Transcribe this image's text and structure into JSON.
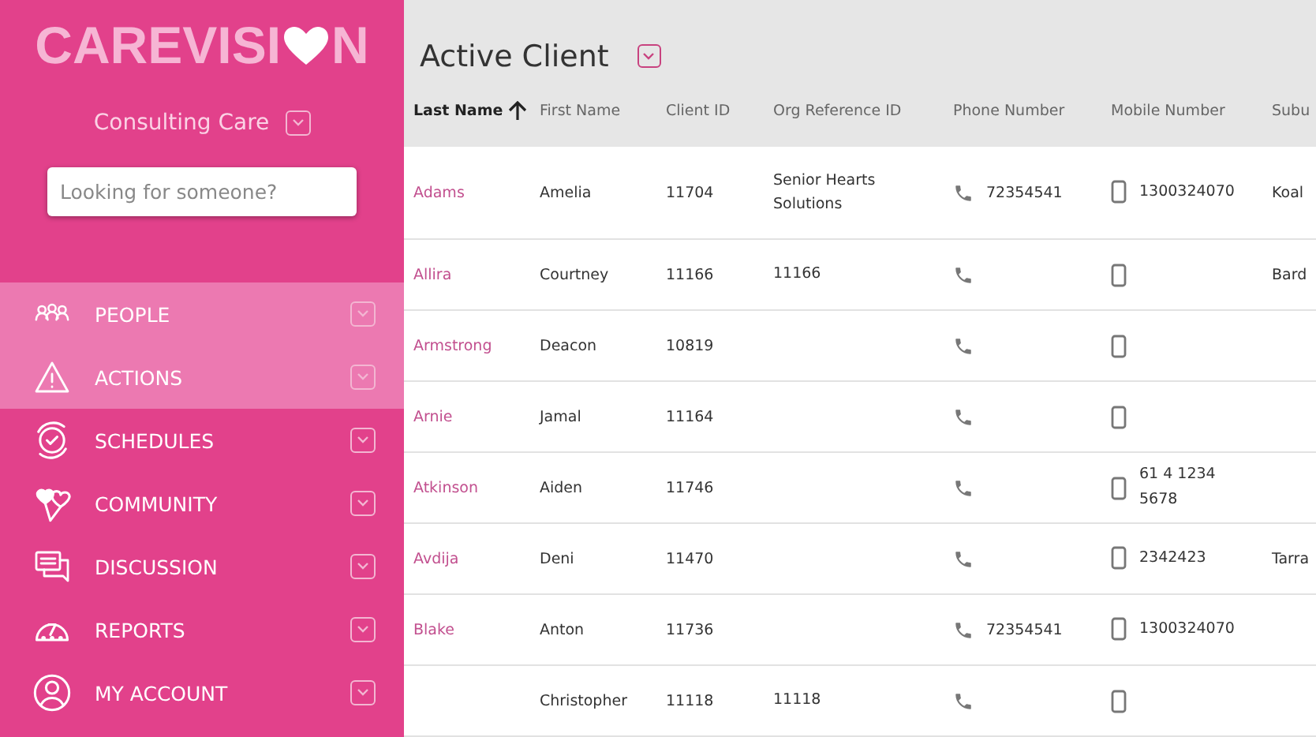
{
  "sidebar": {
    "logo": {
      "before": "CAREVISI",
      "after": "N"
    },
    "organisation": "Consulting Care",
    "search": {
      "placeholder": "Looking for someone?"
    },
    "items": [
      {
        "label": "PEOPLE",
        "kind": "people",
        "selected": true
      },
      {
        "label": "ACTIONS",
        "kind": "warning",
        "selected": true
      },
      {
        "label": "SCHEDULES",
        "kind": "clock",
        "selected": false
      },
      {
        "label": "COMMUNITY",
        "kind": "hearts",
        "selected": false
      },
      {
        "label": "DISCUSSION",
        "kind": "chat",
        "selected": false
      },
      {
        "label": "REPORTS",
        "kind": "gauge",
        "selected": false
      },
      {
        "label": "MY ACCOUNT",
        "kind": "user",
        "selected": false
      }
    ]
  },
  "page": {
    "title": "Active Client"
  },
  "table": {
    "columns": [
      {
        "label": "Last Name",
        "sorted": true
      },
      {
        "label": "First Name",
        "sorted": false
      },
      {
        "label": "Client ID",
        "sorted": false
      },
      {
        "label": "Org Reference ID",
        "sorted": false
      },
      {
        "label": "Phone Number",
        "sorted": false
      },
      {
        "label": "Mobile Number",
        "sorted": false
      },
      {
        "label": "Subu",
        "sorted": false
      }
    ],
    "rows": [
      {
        "last_name": "Adams",
        "first_name": "Amelia",
        "client_id": "11704",
        "org_reference_id": "Senior Hearts Solutions",
        "phone": "72354541",
        "mobile": "1300324070",
        "column_7": "Koal"
      },
      {
        "last_name": "Allira",
        "first_name": "Courtney",
        "client_id": "11166",
        "org_reference_id": "11166",
        "column_7": "Bard"
      },
      {
        "last_name": "Armstrong",
        "first_name": "Deacon",
        "client_id": "10819"
      },
      {
        "last_name": "Arnie",
        "first_name": "Jamal",
        "client_id": "11164"
      },
      {
        "last_name": "Atkinson",
        "first_name": "Aiden",
        "client_id": "11746",
        "mobile": "61 4 1234 5678"
      },
      {
        "last_name": "Avdija",
        "first_name": "Deni",
        "client_id": "11470",
        "mobile": "2342423",
        "column_7": "Tarra"
      },
      {
        "last_name": "Blake",
        "first_name": "Anton",
        "client_id": "11736",
        "phone": "72354541",
        "mobile": "1300324070"
      },
      {
        "first_name": "Christopher",
        "client_id": "11118",
        "org_reference_id": "11118"
      }
    ]
  }
}
